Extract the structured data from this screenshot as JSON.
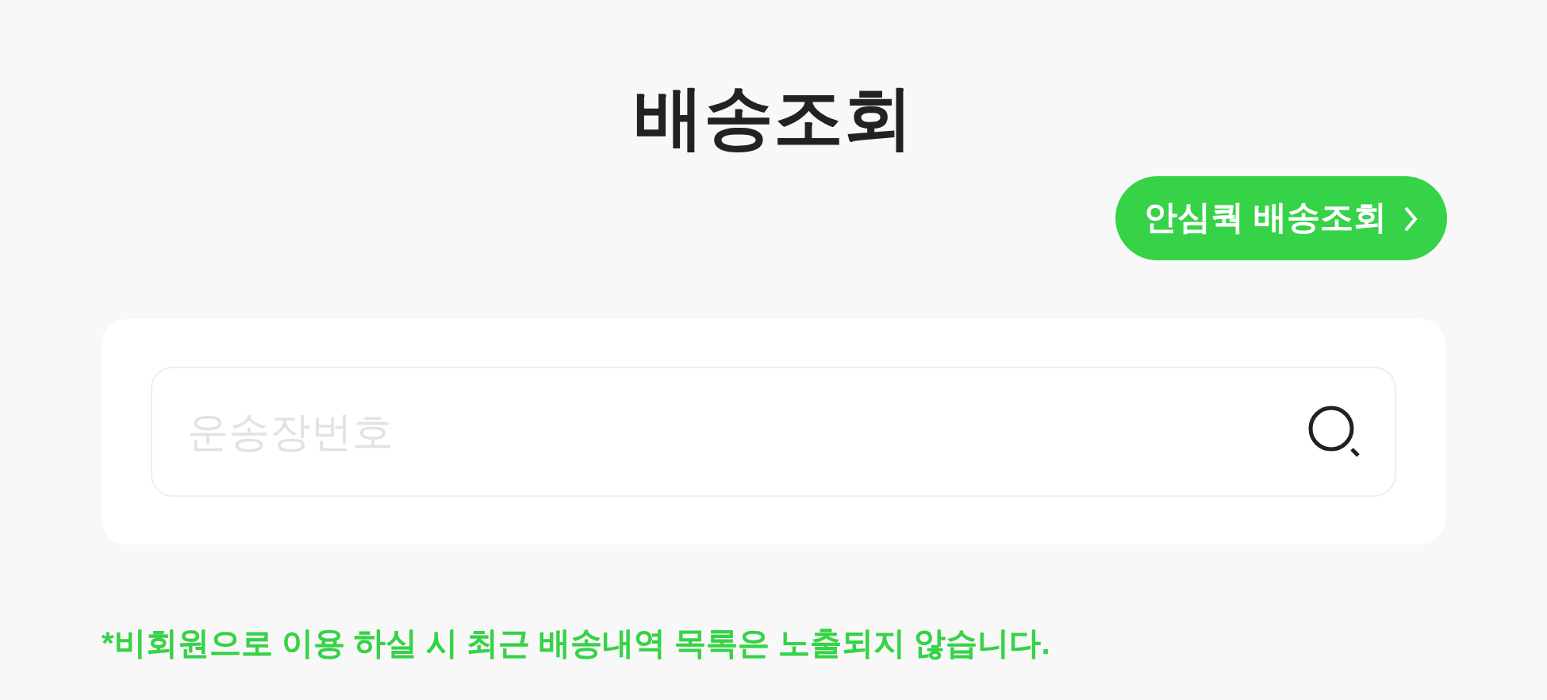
{
  "title": "배송조회",
  "safe_tracking_button": {
    "label": "안심쿽 배송조회"
  },
  "search": {
    "placeholder": "운송장번호"
  },
  "notice": "*비회원으로 이용 하실 시 최근 배송내역 목록은 노출되지 않습니다."
}
